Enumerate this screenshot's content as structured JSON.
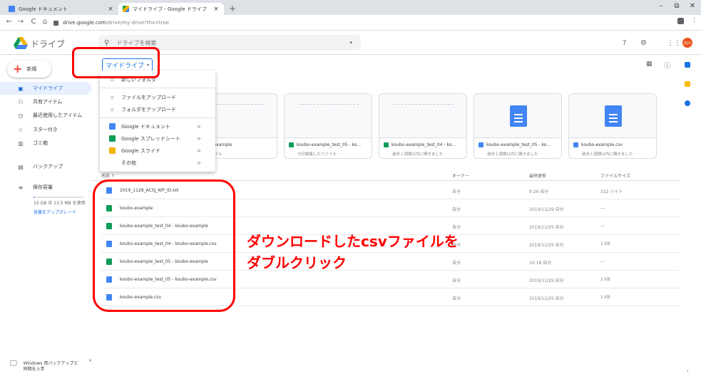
{
  "browser": {
    "tabs": [
      {
        "title": "Google ドキュメント",
        "active": false
      },
      {
        "title": "マイドライブ - Google ドライブ",
        "active": true
      }
    ],
    "new_tab": "+",
    "url_host": "drive.google.com",
    "url_path": "/drive/my-drive?ths=true",
    "window_controls": [
      "–",
      "⧉",
      "✕"
    ]
  },
  "header": {
    "product": "ドライブ",
    "search_placeholder": "ドライブを検索",
    "avatar_text": "北川"
  },
  "sidebar": {
    "new_label": "新規",
    "items": [
      {
        "label": "マイドライブ",
        "icon": "drive-icon",
        "glyph": "▣",
        "selected": true
      },
      {
        "label": "共有アイテム",
        "icon": "shared-icon",
        "glyph": "👥",
        "selected": false
      },
      {
        "label": "最近使用したアイテム",
        "icon": "recent-icon",
        "glyph": "◷",
        "selected": false
      },
      {
        "label": "スター付き",
        "icon": "star-icon",
        "glyph": "☆",
        "selected": false
      },
      {
        "label": "ゴミ箱",
        "icon": "trash-icon",
        "glyph": "🗑",
        "selected": false
      },
      {
        "label": "バックアップ",
        "icon": "backup-icon",
        "glyph": "▤",
        "selected": false
      },
      {
        "label": "保存容量",
        "icon": "storage-icon",
        "glyph": "≡",
        "selected": false
      }
    ],
    "storage_text": "15 GB 中 13.5 MB を使用",
    "storage_fraction": 0.001,
    "upgrade": "容量をアップグレード",
    "backup_promo_line1": "Windows 用バックアップと",
    "backup_promo_line2": "同期を入手",
    "backup_close": "×"
  },
  "toolbar": {
    "breadcrumb": "マイドライブ",
    "caret": "▾"
  },
  "menu": {
    "items": [
      {
        "label": "新しいフォルダ",
        "icon": "new-folder-icon",
        "glyph": "▫",
        "sub": ""
      },
      {
        "label": "ファイルをアップロード",
        "icon": "file-upload-icon",
        "glyph": "▫",
        "sub": ""
      },
      {
        "label": "フォルダをアップロード",
        "icon": "folder-upload-icon",
        "glyph": "▫",
        "sub": ""
      },
      {
        "label": "Google ドキュメント",
        "icon": "docs-icon",
        "color": "#4285f4",
        "sub": ">"
      },
      {
        "label": "Google スプレッドシート",
        "icon": "sheets-icon",
        "color": "#0f9d58",
        "sub": ">"
      },
      {
        "label": "Google スライド",
        "icon": "slides-icon",
        "color": "#f4b400",
        "sub": ">"
      },
      {
        "label": "その他",
        "icon": "more-icon",
        "glyph": "",
        "sub": ">"
      }
    ]
  },
  "quick_access": [
    {
      "name": "kobo-example",
      "sub": "たファイル",
      "type": "sheet"
    },
    {
      "name": "koubo-example_test_05 - ko...",
      "sub": "今日編集したファイル",
      "type": "sheet"
    },
    {
      "name": "koubo-example_test_04 - ko...",
      "sub": "過去１週間以内に開きました",
      "type": "sheet"
    },
    {
      "name": "koubo-example_test_05 - ko...",
      "sub": "過去１週間以内に開きました",
      "type": "doc"
    },
    {
      "name": "koubo-example.csv",
      "sub": "過去１週間以内に開きました",
      "type": "doc"
    }
  ],
  "list_header": {
    "name": "名前 ↑",
    "owner": "オーナー",
    "modified": "最終更新",
    "size": "ファイルサイズ"
  },
  "files": [
    {
      "name": "2019_1128_ACSJ_WP_ID.txt",
      "type": "doc",
      "owner": "自分",
      "modified": "9:26 自分",
      "size": "322 バイト"
    },
    {
      "name": "koubo-example",
      "type": "sheet",
      "owner": "自分",
      "modified": "2019/11/29 自分",
      "size": "—"
    },
    {
      "name": "koubo-example_test_04 - koubo-example",
      "type": "sheet",
      "owner": "自分",
      "modified": "2019/11/29 自分",
      "size": "—"
    },
    {
      "name": "koubo-example_test_04 - koubo-example.csv",
      "type": "doc",
      "owner": "自分",
      "modified": "2019/11/29 自分",
      "size": "1 KB"
    },
    {
      "name": "koubo-example_test_05 - koubo-example",
      "type": "sheet",
      "owner": "自分",
      "modified": "10:18 自分",
      "size": "—"
    },
    {
      "name": "koubo-example_test_05 - koubo-example.csv",
      "type": "doc",
      "owner": "自分",
      "modified": "2019/11/29 自分",
      "size": "1 KB"
    },
    {
      "name": "koubo-example.csv",
      "type": "doc",
      "owner": "自分",
      "modified": "2019/11/29 自分",
      "size": "1 KB"
    }
  ],
  "annotation": {
    "line1": "ダウンロードしたcsvファイルを",
    "line2": "ダブルクリック"
  },
  "colors": {
    "accent": "#1a73e8",
    "annotation": "#ff0000",
    "doc": "#4285f4",
    "sheet": "#0f9d58",
    "slide": "#f4b400"
  }
}
